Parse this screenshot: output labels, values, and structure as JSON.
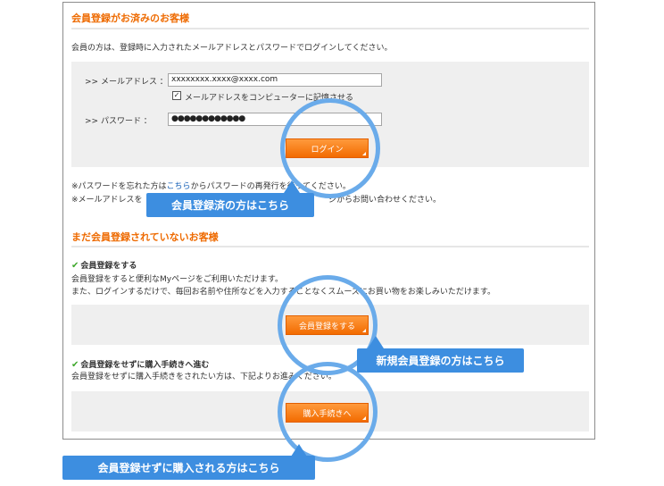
{
  "registered": {
    "title": "会員登録がお済みのお客様",
    "intro": "会員の方は、登録時に入力されたメールアドレスとパスワードでログインしてください。",
    "email_label": ">> メールアドレス ：",
    "email_value": "xxxxxxxx.xxxx@xxxx.com",
    "remember_label": "メールアドレスをコンピューターに記憶させる",
    "password_label": ">> パスワード ：",
    "password_value": "●●●●●●●●●●●●",
    "login_button": "ログイン",
    "forgot_prefix": "※パスワードを忘れた方は",
    "forgot_link": "こちら",
    "forgot_suffix": "からパスワードの再発行を行ってください。",
    "email_note_prefix": "※メールアドレスを",
    "email_note_suffix": "ジからお問い合わせください。"
  },
  "unregistered": {
    "title": "まだ会員登録されていないお客様",
    "register_heading": "会員登録をする",
    "register_line1": "会員登録をすると便利なMyページをご利用いただけます。",
    "register_line2": "また、ログインするだけで、毎回お名前や住所などを入力することなくスムーズにお買い物をお楽しみいただけます。",
    "register_button": "会員登録をする",
    "guest_heading": "会員登録をせずに購入手続きへ進む",
    "guest_line": "会員登録をせずに購入手続きをされたい方は、下記よりお進みください。",
    "guest_button": "購入手続きへ"
  },
  "callouts": {
    "member": "会員登録済の方はこちら",
    "new_member": "新規会員登録の方はこちら",
    "guest": "会員登録せずに購入される方はこちら"
  },
  "colors": {
    "accent_orange": "#ee6a00",
    "callout_blue": "#3d8ee0",
    "circle_blue": "#6aabea"
  }
}
